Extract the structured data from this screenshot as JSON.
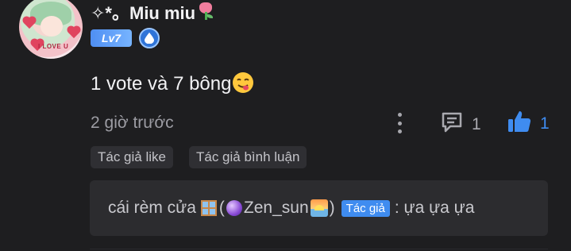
{
  "comment": {
    "user": {
      "name": "✧*。Miu miu",
      "level": "Lv7",
      "avatar_text": "I LOVE U"
    },
    "text": "1 vote và 7 bông",
    "time": "2 giờ trước",
    "comment_count": "1",
    "like_count": "1",
    "tags": [
      "Tác giả like",
      "Tác giả bình luận"
    ],
    "reply": {
      "prefix": "cái rèm cửa",
      "open_paren": "(",
      "author_name": "Zen_sun",
      "close_paren": ")",
      "author_tag": "Tác giả",
      "body": ": ựa ựa ựa"
    }
  },
  "colors": {
    "background": "#1e1e20",
    "level_badge": "#4f8ff3",
    "like_accent": "#3f8cf0",
    "tag_bg": "#2f2f33",
    "reply_bg": "#2c2c2f"
  },
  "icons": [
    "tulip-icon",
    "drop-badge-icon",
    "face-savoring-emoji",
    "more-options-icon",
    "comment-icon",
    "thumbs-up-icon",
    "window-emoji",
    "crystal-ball-emoji",
    "sunrise-emoji"
  ]
}
